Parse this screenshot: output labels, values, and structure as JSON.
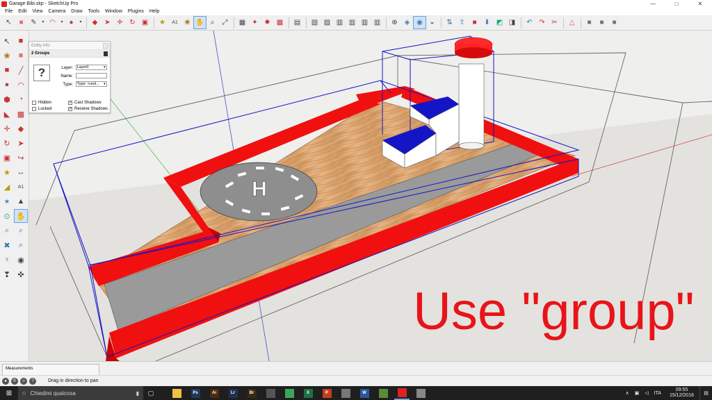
{
  "window": {
    "title": "Garage Bibi.skp - SketchUp Pro",
    "min": "—",
    "max": "□",
    "close": "✕"
  },
  "menu": [
    "File",
    "Edit",
    "View",
    "Camera",
    "Draw",
    "Tools",
    "Window",
    "Plugins",
    "Help"
  ],
  "entity_info": {
    "title": "Entity Info",
    "selection": "2 Groups",
    "layer_label": "Layer:",
    "layer_value": "Layer0",
    "name_label": "Name:",
    "name_value": "",
    "type_label": "Type:",
    "type_value": "Type: <und...",
    "hidden": "Hidden",
    "locked": "Locked",
    "cast_shadows": "Cast Shadows",
    "receive_shadows": "Receive Shadows",
    "cast_checked": true,
    "receive_checked": true
  },
  "overlay_text": "Use \"group\"",
  "measurements_label": "Measurements",
  "status_message": "Drag in direction to pan",
  "taskbar": {
    "search_placeholder": "Chiedimi qualcosa",
    "language": "ITA",
    "time": "09:55",
    "date": "15/12/2016",
    "apps": [
      {
        "name": "file-explorer",
        "label": "",
        "color": "#f0c040"
      },
      {
        "name": "photoshop",
        "label": "Ps",
        "color": "#1e3a5f"
      },
      {
        "name": "illustrator",
        "label": "Ai",
        "color": "#4a2a0a"
      },
      {
        "name": "lightroom",
        "label": "Lr",
        "color": "#1f3350"
      },
      {
        "name": "bridge",
        "label": "Br",
        "color": "#3a2a10"
      },
      {
        "name": "media-player",
        "label": "",
        "color": "#555"
      },
      {
        "name": "chrome",
        "label": "",
        "color": "#3aa757"
      },
      {
        "name": "excel",
        "label": "X",
        "color": "#1e7145"
      },
      {
        "name": "powerpoint",
        "label": "P",
        "color": "#c43e1c"
      },
      {
        "name": "sticky-notes",
        "label": "",
        "color": "#777"
      },
      {
        "name": "word",
        "label": "W",
        "color": "#2b579a"
      },
      {
        "name": "sketchup-tray",
        "label": "",
        "color": "#5b8a3a"
      },
      {
        "name": "sketchup",
        "label": "",
        "color": "#d22"
      },
      {
        "name": "other-app",
        "label": "",
        "color": "#888"
      }
    ]
  },
  "colors": {
    "accent_red": "#e8141a",
    "selection_blue": "#1515c8",
    "wood": "#d9a371",
    "ramp_gray": "#9a9a9a"
  }
}
